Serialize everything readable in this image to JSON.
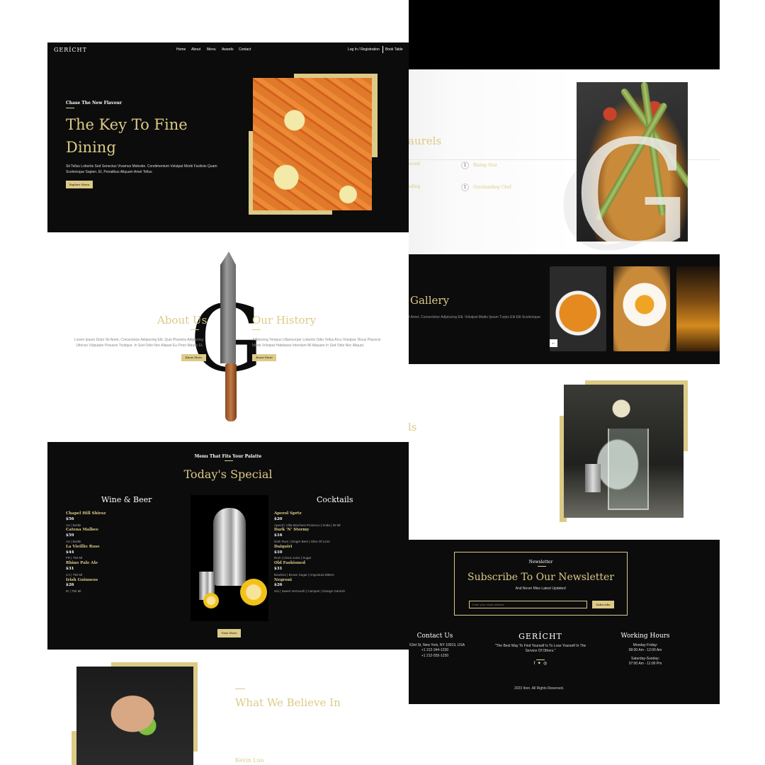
{
  "hero": {
    "logo": "GERÍCHT",
    "nav": [
      "Home",
      "About",
      "Menu",
      "Awards",
      "Contact"
    ],
    "login": "Log In / Registration",
    "book": "Book Table",
    "subtitle": "Chase The New Flavour",
    "title": "The Key To Fine Dining",
    "text": "Sit Tellus Lobortis Sed Senectus Vivamus Molestie. Condimentum Volutpat Morbi Facilisis Quam Scelerisque Sapien. Et, Penatibus Aliquam Amet Tellus",
    "button": "Explore Menu"
  },
  "about": {
    "about_title": "About Us",
    "about_text": "Lorem Ipsum Dolor Sit Amet, Consectetur Adipiscing Elit. Quis Pharetra Adipiscing Ultrices Vulputate Posuere Tristique. In Sed Odio Nec Aliquet Eu Proin Mauris Et.",
    "about_button": "Know More",
    "history_title": "Our History",
    "history_text": "Adipiscing Tempus Ullamcorper Lobortis Odio Tellus Arcu Volutpat. Risus Placerat Morbi Volutpat Habitasse Interdum Mi Aliquam In Sed Odio Nec Aliquet.",
    "history_button": "Know More"
  },
  "special": {
    "subtitle": "Menu That Fits Your Palatte",
    "title": "Today's Special",
    "wine_heading": "Wine & Beer",
    "cocktails_heading": "Cocktails",
    "wine": [
      {
        "name": "Chapel Hill Shiraz",
        "price": "$56",
        "desc": "AU | Bottle"
      },
      {
        "name": "Catena Malbee",
        "price": "$59",
        "desc": "AU | Bottle"
      },
      {
        "name": "La Vieillie Rose",
        "price": "$44",
        "desc": "FR | 750 Ml"
      },
      {
        "name": "Rhino Pale Ale",
        "price": "$31",
        "desc": "CA | 750 Ml"
      },
      {
        "name": "Irish Guinness",
        "price": "$26",
        "desc": "IE | 750 Ml"
      }
    ],
    "cocktails": [
      {
        "name": "Aperol Sprtz",
        "price": "$20",
        "desc": "Aperol | Villa Marchesi Prosecco | Soda | 30 Ml"
      },
      {
        "name": "Dark 'N' Stormy",
        "price": "$16",
        "desc": "Dark Rum | Ginger Beer | Slice Of Lime"
      },
      {
        "name": "Daiquiri",
        "price": "$10",
        "desc": "Rum | Citrus Juice | Sugar"
      },
      {
        "name": "Old Fashioned",
        "price": "$31",
        "desc": "Bourbon | Brown Sugar | Angostura Bitters"
      },
      {
        "name": "Negroni",
        "price": "$26",
        "desc": "Gin | Sweet Vermouth | Campari | Orange Garnish"
      }
    ],
    "button": "View More"
  },
  "believe": {
    "title": "What We Believe In",
    "chef_name": "Kevin Luo"
  },
  "laurels": {
    "title_partial": "aurels",
    "awards": [
      {
        "num": "1",
        "label": "Rising Star",
        "left_partial": "mond"
      },
      {
        "num": "1",
        "label": "Outstanding Chef",
        "left_partial": "uding"
      }
    ]
  },
  "gallery": {
    "title": "Gallery",
    "text": "it Amet, Consectetur Adipiscing Elit. Volutpat Mattis Ipsum Turpis Elit Elit Scelerisque",
    "arrow": "←"
  },
  "intro": {
    "title_partial": "ls"
  },
  "newsletter": {
    "label": "Newsletter",
    "title": "Subscribe To Our Newsletter",
    "subtitle": "And Never Miss Latest Updates!",
    "placeholder": "Enter your email address",
    "button": "Subscribe"
  },
  "footer": {
    "contact_title": "Contact Us",
    "address": "W 53rd St, New York, NY 10019, USA",
    "phone1": "+1 212-344-1230",
    "phone2": "+1 212-555-1230",
    "logo": "GERÍCHT",
    "quote": "\"The Best Way To Find Yourself Is To Lose Yourself In The Service Of Others.\"",
    "hours_title": "Working Hours",
    "weekday_label": "Monday-Friday:",
    "weekday_hours": "08:00 Am - 12:00 Am",
    "weekend_label": "Saturday-Sunday:",
    "weekend_hours": "07:00 Am - 11:00 Pm",
    "copyright": "2023 Ibon. All Rights Reserved.",
    "social_icons": [
      "facebook-icon",
      "twitter-icon",
      "instagram-icon"
    ]
  },
  "colors": {
    "gold": "#DCCA87",
    "black": "#0C0C0C",
    "white": "#FFFFFF"
  }
}
